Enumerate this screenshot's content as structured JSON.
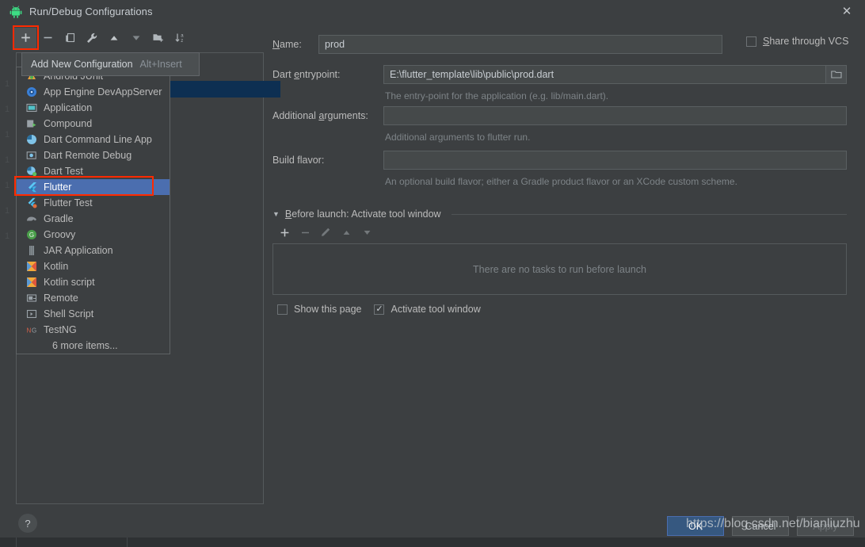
{
  "window": {
    "title": "Run/Debug Configurations",
    "app_icon": "android-robot-icon",
    "close_label": "✕"
  },
  "toolbar": {
    "buttons": [
      {
        "name": "add-configuration",
        "icon": "plus-icon",
        "glyph": "+"
      },
      {
        "name": "remove-configuration",
        "icon": "minus-icon",
        "glyph": "−"
      },
      {
        "name": "copy-configuration",
        "icon": "copy-icon",
        "glyph": "⧉"
      },
      {
        "name": "edit-templates",
        "icon": "wrench-icon",
        "glyph": "🔧"
      },
      {
        "name": "move-up",
        "icon": "triangle-up-icon",
        "glyph": "▲"
      },
      {
        "name": "move-down",
        "icon": "triangle-down-icon",
        "glyph": "▼"
      },
      {
        "name": "move-into-folder",
        "icon": "folder-add-icon",
        "glyph": "🗂"
      },
      {
        "name": "sort-configurations",
        "icon": "sort-az-icon",
        "glyph": "↓az"
      }
    ]
  },
  "tooltip": {
    "label": "Add New Configuration",
    "shortcut": "Alt+Insert"
  },
  "popup": {
    "items": [
      {
        "label": "Android JUnit",
        "icon": "android-junit-icon",
        "selected": false,
        "clipped": true
      },
      {
        "label": "App Engine DevAppServer",
        "icon": "app-engine-icon",
        "selected": false
      },
      {
        "label": "Application",
        "icon": "application-icon",
        "selected": false
      },
      {
        "label": "Compound",
        "icon": "compound-icon",
        "selected": false
      },
      {
        "label": "Dart Command Line App",
        "icon": "dart-icon",
        "selected": false
      },
      {
        "label": "Dart Remote Debug",
        "icon": "dart-remote-debug-icon",
        "selected": false
      },
      {
        "label": "Dart Test",
        "icon": "dart-test-icon",
        "selected": false
      },
      {
        "label": "Flutter",
        "icon": "flutter-icon",
        "selected": true
      },
      {
        "label": "Flutter Test",
        "icon": "flutter-test-icon",
        "selected": false
      },
      {
        "label": "Gradle",
        "icon": "gradle-icon",
        "selected": false
      },
      {
        "label": "Groovy",
        "icon": "groovy-icon",
        "selected": false
      },
      {
        "label": "JAR Application",
        "icon": "jar-icon",
        "selected": false
      },
      {
        "label": "Kotlin",
        "icon": "kotlin-icon",
        "selected": false
      },
      {
        "label": "Kotlin script",
        "icon": "kotlin-script-icon",
        "selected": false
      },
      {
        "label": "Remote",
        "icon": "remote-icon",
        "selected": false
      },
      {
        "label": "Shell Script",
        "icon": "shell-script-icon",
        "selected": false
      },
      {
        "label": "TestNG",
        "icon": "testng-icon",
        "selected": false
      }
    ],
    "more_label": "6 more items..."
  },
  "gutter_numbers": [
    "1",
    "1",
    "1",
    "1",
    "1",
    "1",
    "1"
  ],
  "form": {
    "name_label": "Name:",
    "name_label_mnemonic": "N",
    "name_value": "prod",
    "share_label": "Share through VCS",
    "share_label_mnemonic": "S",
    "share_checked": false,
    "entrypoint_label": "Dart entrypoint:",
    "entrypoint_label_mnemonic": "e",
    "entrypoint_value": "E:\\flutter_template\\lib\\public\\prod.dart",
    "entrypoint_hint": "The entry-point for the application (e.g. lib/main.dart).",
    "browse_icon": "folder-icon",
    "args_label": "Additional arguments:",
    "args_label_mnemonic": "a",
    "args_value": "",
    "args_hint": "Additional arguments to flutter run.",
    "flavor_label": "Build flavor:",
    "flavor_value": "",
    "flavor_hint": "An optional build flavor; either a Gradle product flavor or an XCode custom scheme."
  },
  "before_launch": {
    "title": "Before launch: Activate tool window",
    "title_mnemonic": "B",
    "collapse_glyph": "▼",
    "toolbar": [
      {
        "name": "add-task",
        "icon": "plus-icon",
        "glyph": "+",
        "enabled": true
      },
      {
        "name": "remove-task",
        "icon": "minus-icon",
        "glyph": "−",
        "enabled": false
      },
      {
        "name": "edit-task",
        "icon": "pencil-icon",
        "glyph": "✎",
        "enabled": false
      },
      {
        "name": "move-task-up",
        "icon": "triangle-up-icon",
        "glyph": "▲",
        "enabled": false
      },
      {
        "name": "move-task-down",
        "icon": "triangle-down-icon",
        "glyph": "▼",
        "enabled": false
      }
    ],
    "empty_message": "There are no tasks to run before launch",
    "show_page_label": "Show this page",
    "show_page_checked": false,
    "activate_tool_window_label": "Activate tool window",
    "activate_tool_window_checked": true,
    "checkmark": "✓"
  },
  "buttons": {
    "ok": "OK",
    "cancel": "Cancel",
    "apply": "Apply"
  },
  "help": {
    "glyph": "?"
  },
  "watermark": "https://blog.csdn.net/bianliuzhu",
  "colors": {
    "window_bg": "#3c3f41",
    "accent_selected": "#4b6eaf",
    "ok_button": "#365880",
    "highlight_red": "#ff2a00",
    "tree_selection_strip": "#0d2f52"
  }
}
